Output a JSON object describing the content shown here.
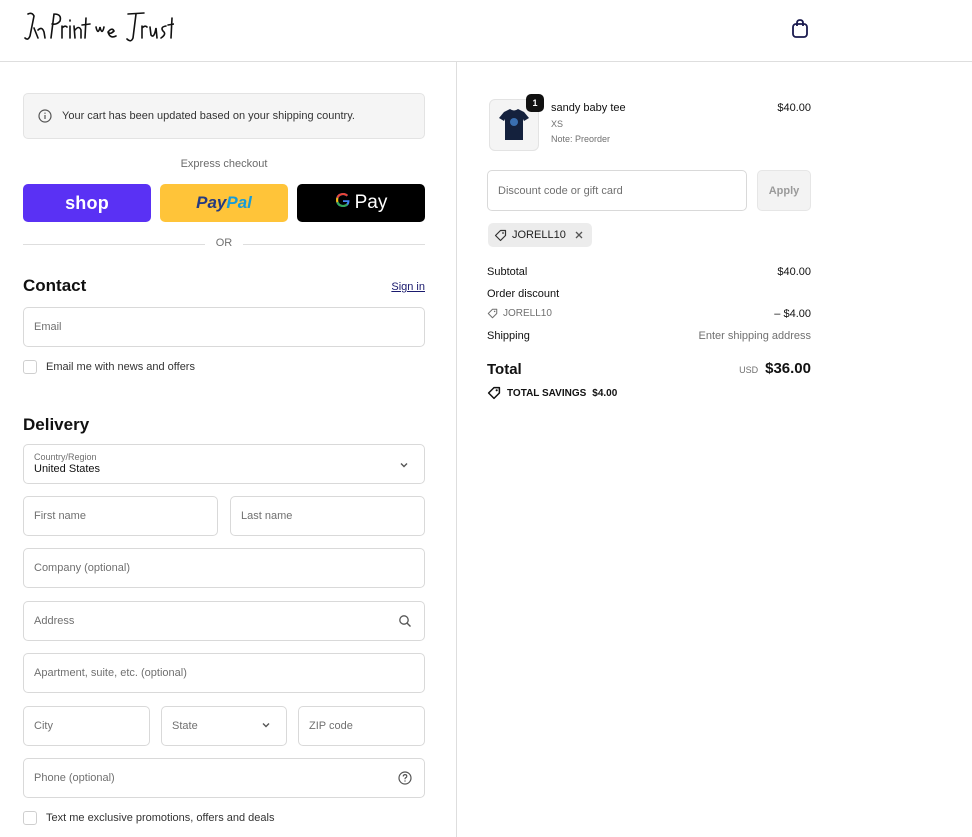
{
  "brand": {
    "logo_text": "In Print we Trust"
  },
  "header": {
    "cart_icon": "shopping-bag-icon"
  },
  "banner": {
    "icon": "info-icon",
    "text": "Your cart has been updated based on your shipping country."
  },
  "express": {
    "label": "Express checkout",
    "shop_label": "shop",
    "paypal_label_a": "Pay",
    "paypal_label_b": "Pal",
    "gpay_g": "G",
    "gpay_label": "Pay",
    "or_label": "OR"
  },
  "contact": {
    "title": "Contact",
    "signin_label": "Sign in",
    "email_placeholder": "Email",
    "newsletter_label": "Email me with news and offers"
  },
  "delivery": {
    "title": "Delivery",
    "country_label": "Country/Region",
    "country_value": "United States",
    "first_name_placeholder": "First name",
    "last_name_placeholder": "Last name",
    "company_placeholder": "Company (optional)",
    "address_placeholder": "Address",
    "apartment_placeholder": "Apartment, suite, etc. (optional)",
    "city_placeholder": "City",
    "state_placeholder": "State",
    "zip_placeholder": "ZIP code",
    "phone_placeholder": "Phone (optional)",
    "sms_label": "Text me exclusive promotions, offers and deals"
  },
  "order": {
    "item": {
      "name": "sandy baby tee",
      "variant": "XS",
      "note": "Note: Preorder",
      "price": "$40.00",
      "quantity": "1"
    },
    "discount_placeholder": "Discount code or gift card",
    "apply_label": "Apply",
    "applied_code": "JORELL10",
    "subtotal_label": "Subtotal",
    "subtotal_value": "$40.00",
    "order_discount_label": "Order discount",
    "discount_code": "JORELL10",
    "discount_value": "– $4.00",
    "shipping_label": "Shipping",
    "shipping_value": "Enter shipping address",
    "total_label": "Total",
    "currency": "USD",
    "total_value": "$36.00",
    "savings_label": "TOTAL SAVINGS",
    "savings_value": "$4.00"
  },
  "colors": {
    "shop_purple": "#5a31f4",
    "paypal_yellow": "#ffc439",
    "gpay_black": "#000000"
  }
}
